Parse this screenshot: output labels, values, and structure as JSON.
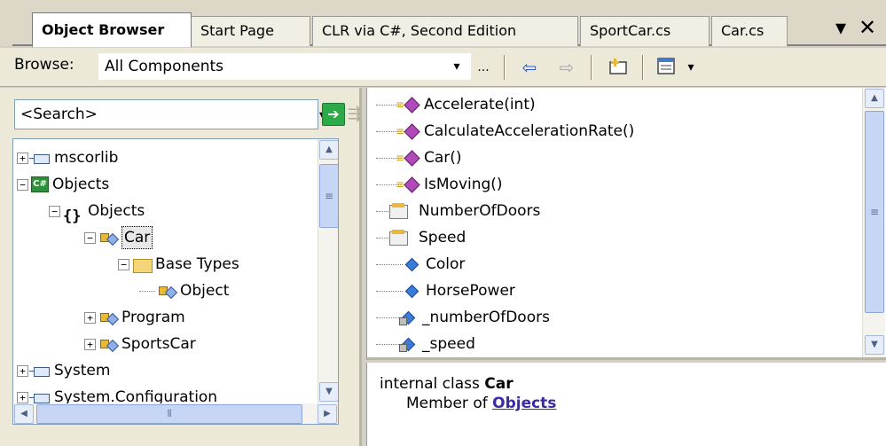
{
  "tabs": [
    {
      "label": "Object Browser",
      "active": true
    },
    {
      "label": "Start Page",
      "active": false
    },
    {
      "label": "CLR via C#, Second Edition",
      "active": false
    },
    {
      "label": "SportCar.cs",
      "active": false
    },
    {
      "label": "Car.cs",
      "active": false
    }
  ],
  "window": {
    "pin_glyph": "▾",
    "close_glyph": "✕"
  },
  "toolbar": {
    "browse_label": "Browse:",
    "browse_value": "All Components",
    "dropdown_glyph": "▾",
    "ellipsis": "...",
    "back_glyph": "⇦",
    "forward_glyph": "⇨",
    "add_ref_icon": "add-reference-icon",
    "settings_icon": "settings-icon",
    "settings_dropdown_glyph": "▾"
  },
  "search": {
    "placeholder": "<Search>",
    "go_glyph": "➔",
    "clear_glyph": "⇶"
  },
  "tree": [
    {
      "label": "mscorlib",
      "icon": "assembly",
      "expander": "+",
      "level": 0
    },
    {
      "label": "Objects",
      "icon": "csharp-project",
      "expander": "−",
      "level": 0
    },
    {
      "label": "Objects",
      "icon": "namespace",
      "expander": "−",
      "level": 1
    },
    {
      "label": "Car",
      "icon": "class",
      "expander": "−",
      "level": 2,
      "selected": true
    },
    {
      "label": "Base Types",
      "icon": "folder",
      "expander": "−",
      "level": 3
    },
    {
      "label": "Object",
      "icon": "class",
      "expander": "",
      "level": 4
    },
    {
      "label": "Program",
      "icon": "class",
      "expander": "+",
      "level": 2
    },
    {
      "label": "SportsCar",
      "icon": "class",
      "expander": "+",
      "level": 2
    },
    {
      "label": "System",
      "icon": "assembly",
      "expander": "+",
      "level": 0
    },
    {
      "label": "System.Configuration",
      "icon": "assembly",
      "expander": "+",
      "level": 0
    }
  ],
  "members": [
    {
      "label": "Accelerate(int)",
      "kind": "method"
    },
    {
      "label": "CalculateAccelerationRate()",
      "kind": "method"
    },
    {
      "label": "Car()",
      "kind": "method"
    },
    {
      "label": "IsMoving()",
      "kind": "method"
    },
    {
      "label": "NumberOfDoors",
      "kind": "property"
    },
    {
      "label": "Speed",
      "kind": "property"
    },
    {
      "label": "Color",
      "kind": "field"
    },
    {
      "label": "HorsePower",
      "kind": "field"
    },
    {
      "label": "_numberOfDoors",
      "kind": "private-field"
    },
    {
      "label": "_speed",
      "kind": "private-field"
    }
  ],
  "description": {
    "declaration_prefix": "internal class",
    "declaration_name": "Car",
    "member_of_label": "Member of",
    "member_of_link": "Objects"
  },
  "scroll": {
    "up_glyph": "▲",
    "down_glyph": "▼",
    "left_glyph": "◀",
    "right_glyph": "▶",
    "grip": "≡",
    "hgrip": "⦀"
  }
}
